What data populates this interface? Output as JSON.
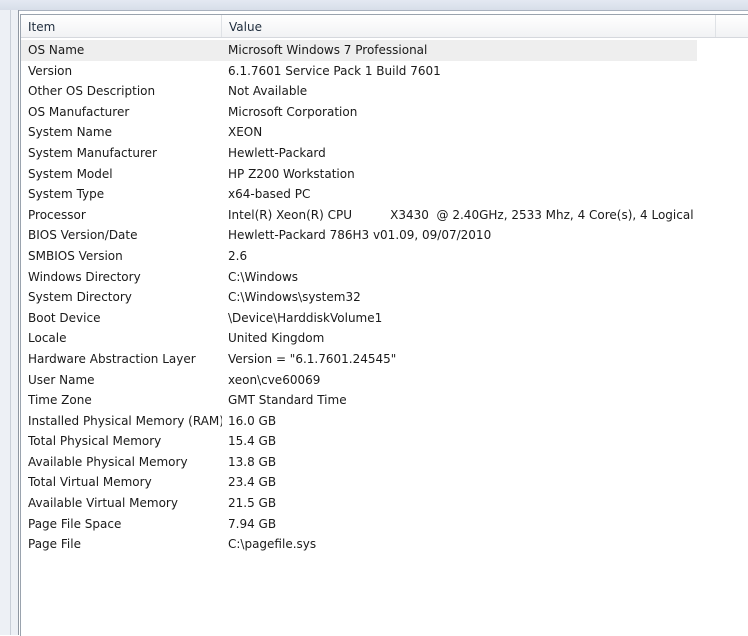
{
  "columns": {
    "item": "Item",
    "value": "Value"
  },
  "rows": [
    {
      "item": "OS Name",
      "value": "Microsoft Windows 7 Professional"
    },
    {
      "item": "Version",
      "value": "6.1.7601 Service Pack 1 Build 7601"
    },
    {
      "item": "Other OS Description",
      "value": "Not Available"
    },
    {
      "item": "OS Manufacturer",
      "value": "Microsoft Corporation"
    },
    {
      "item": "System Name",
      "value": "XEON"
    },
    {
      "item": "System Manufacturer",
      "value": "Hewlett-Packard"
    },
    {
      "item": "System Model",
      "value": "HP Z200 Workstation"
    },
    {
      "item": "System Type",
      "value": "x64-based PC"
    },
    {
      "item": "Processor",
      "value": "Intel(R) Xeon(R) CPU          X3430  @ 2.40GHz, 2533 Mhz, 4 Core(s), 4 Logical..."
    },
    {
      "item": "BIOS Version/Date",
      "value": "Hewlett-Packard 786H3 v01.09, 09/07/2010"
    },
    {
      "item": "SMBIOS Version",
      "value": "2.6"
    },
    {
      "item": "Windows Directory",
      "value": "C:\\Windows"
    },
    {
      "item": "System Directory",
      "value": "C:\\Windows\\system32"
    },
    {
      "item": "Boot Device",
      "value": "\\Device\\HarddiskVolume1"
    },
    {
      "item": "Locale",
      "value": "United Kingdom"
    },
    {
      "item": "Hardware Abstraction Layer",
      "value": "Version = \"6.1.7601.24545\""
    },
    {
      "item": "User Name",
      "value": "xeon\\cve60069"
    },
    {
      "item": "Time Zone",
      "value": "GMT Standard Time"
    },
    {
      "item": "Installed Physical Memory (RAM)",
      "value": "16.0 GB"
    },
    {
      "item": "Total Physical Memory",
      "value": "15.4 GB"
    },
    {
      "item": "Available Physical Memory",
      "value": "13.8 GB"
    },
    {
      "item": "Total Virtual Memory",
      "value": "23.4 GB"
    },
    {
      "item": "Available Virtual Memory",
      "value": "21.5 GB"
    },
    {
      "item": "Page File Space",
      "value": "7.94 GB"
    },
    {
      "item": "Page File",
      "value": "C:\\pagefile.sys"
    }
  ]
}
